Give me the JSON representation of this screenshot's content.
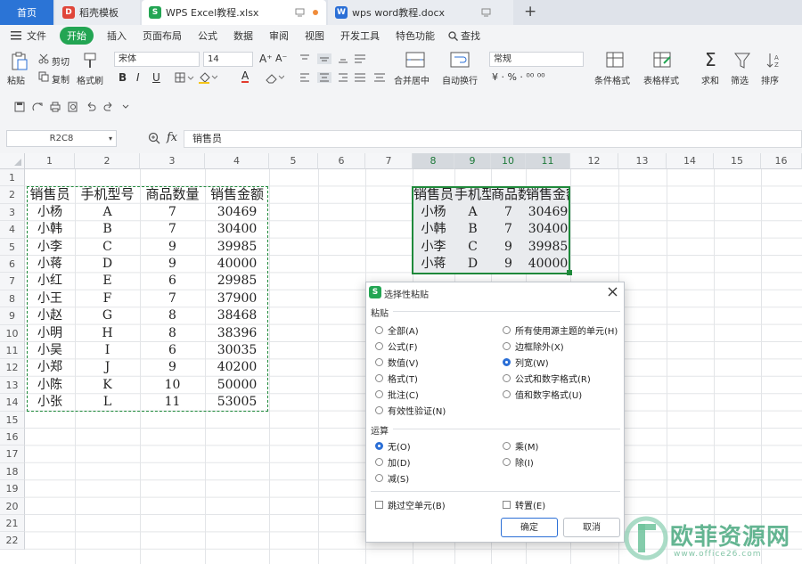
{
  "tabs": {
    "home": "首页",
    "template": "稻壳模板",
    "excel": "WPS Excel教程.xlsx",
    "word": "wps word教程.docx",
    "add": "+"
  },
  "menu": [
    "文件",
    "开始",
    "插入",
    "页面布局",
    "公式",
    "数据",
    "审阅",
    "视图",
    "开发工具",
    "特色功能",
    "查找"
  ],
  "ribbon": {
    "paste": "粘贴",
    "cut": "剪切",
    "copy": "复制",
    "format_painter": "格式刷",
    "font": "宋体",
    "size": "14",
    "merge_center": "合并居中",
    "auto_wrap": "自动换行",
    "number_format": "常规",
    "cond_format": "条件格式",
    "table_style": "表格样式",
    "sum": "求和",
    "filter": "筛选",
    "sort": "排序",
    "bold": "B",
    "italic": "I",
    "underline": "U",
    "font_color": "A"
  },
  "formula_bar": {
    "name_box": "R2C8",
    "fx": "fx",
    "value": "销售员"
  },
  "columns": [
    "1",
    "2",
    "3",
    "4",
    "5",
    "6",
    "7",
    "8",
    "9",
    "10",
    "11",
    "12",
    "13",
    "14",
    "15",
    "16"
  ],
  "rows": [
    "1",
    "2",
    "3",
    "4",
    "5",
    "6",
    "7",
    "8",
    "9",
    "10",
    "11",
    "12",
    "13",
    "14",
    "15",
    "16",
    "17",
    "18",
    "19",
    "20",
    "21",
    "22"
  ],
  "table_left": {
    "headers": [
      "销售员",
      "手机型号",
      "商品数量",
      "销售金额"
    ],
    "rows": [
      [
        "小杨",
        "A",
        "7",
        "30469"
      ],
      [
        "小韩",
        "B",
        "7",
        "30400"
      ],
      [
        "小李",
        "C",
        "9",
        "39985"
      ],
      [
        "小蒋",
        "D",
        "9",
        "40000"
      ],
      [
        "小红",
        "E",
        "6",
        "29985"
      ],
      [
        "小王",
        "F",
        "7",
        "37900"
      ],
      [
        "小赵",
        "G",
        "8",
        "38468"
      ],
      [
        "小明",
        "H",
        "8",
        "38396"
      ],
      [
        "小吴",
        "I",
        "6",
        "30035"
      ],
      [
        "小郑",
        "J",
        "9",
        "40200"
      ],
      [
        "小陈",
        "K",
        "10",
        "50000"
      ],
      [
        "小张",
        "L",
        "11",
        "53005"
      ]
    ]
  },
  "table_right": {
    "headers": [
      "销售员",
      "手机型号",
      "商品数",
      "销售金额"
    ],
    "rows": [
      [
        "小杨",
        "A",
        "7",
        "30469"
      ],
      [
        "小韩",
        "B",
        "7",
        "30400"
      ],
      [
        "小李",
        "C",
        "9",
        "39985"
      ],
      [
        "小蒋",
        "D",
        "9",
        "40000"
      ]
    ]
  },
  "dialog": {
    "title": "选择性粘贴",
    "paste_group": "粘贴",
    "paste_left": [
      "全部(A)",
      "公式(F)",
      "数值(V)",
      "格式(T)",
      "批注(C)",
      "有效性验证(N)"
    ],
    "paste_right": [
      "所有使用源主题的单元(H)",
      "边框除外(X)",
      "列宽(W)",
      "公式和数字格式(R)",
      "值和数字格式(U)"
    ],
    "paste_selected": "列宽(W)",
    "op_group": "运算",
    "op_left": [
      "无(O)",
      "加(D)",
      "减(S)"
    ],
    "op_right": [
      "乘(M)",
      "除(I)"
    ],
    "op_selected": "无(O)",
    "skip_blanks": "跳过空单元(B)",
    "transpose": "转置(E)",
    "ok": "确定",
    "cancel": "取消"
  },
  "watermark": {
    "text": "欧菲资源网",
    "url": "www.office26.com"
  },
  "colors": {
    "accent_green": "#23a553",
    "tab_blue": "#2b74d6",
    "radio_blue": "#2b6fd6",
    "selection_border": "#1f8a3b"
  }
}
